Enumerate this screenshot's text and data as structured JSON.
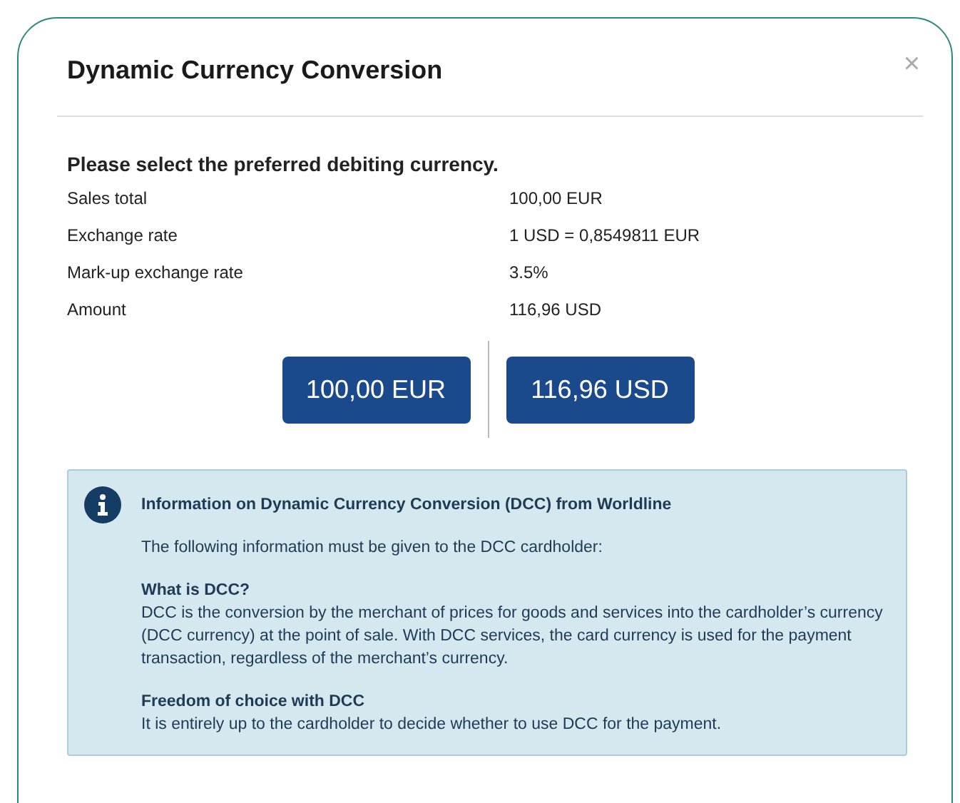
{
  "dialog": {
    "title": "Dynamic Currency Conversion",
    "close": "×"
  },
  "prompt": "Please select the preferred debiting currency.",
  "details": [
    {
      "label": "Sales total",
      "value": "100,00 EUR"
    },
    {
      "label": "Exchange rate",
      "value": "1 USD = 0,8549811 EUR"
    },
    {
      "label": "Mark-up exchange rate",
      "value": "3.5%"
    },
    {
      "label": "Amount",
      "value": "116,96 USD"
    }
  ],
  "currency_buttons": [
    {
      "label": "100,00 EUR"
    },
    {
      "label": "116,96 USD"
    }
  ],
  "info": {
    "heading": "Information on Dynamic Currency Conversion (DCC) from Worldline",
    "intro": "The following information must be given to the DCC cardholder:",
    "sections": [
      {
        "title": "What is DCC?",
        "body": "DCC is the conversion by the merchant of prices for goods and services into the cardholder’s currency (DCC currency) at the point of sale. With DCC services, the card currency is used for the payment transaction, regardless of the merchant’s currency."
      },
      {
        "title": "Freedom of choice with DCC",
        "body": "It is entirely up to the cardholder to decide whether to use DCC for the payment."
      }
    ]
  }
}
